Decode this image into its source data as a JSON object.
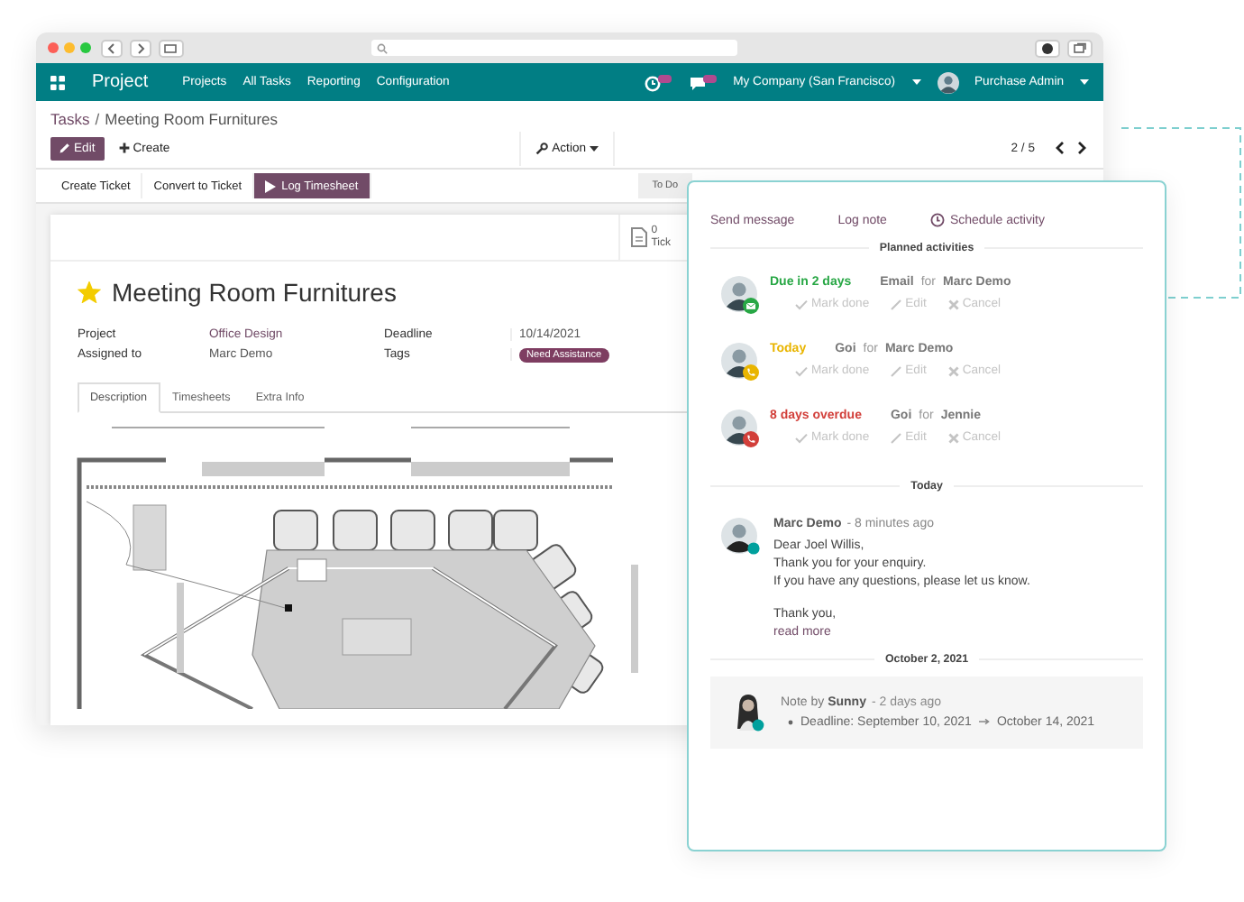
{
  "navbar": {
    "app": "Project",
    "menu": [
      {
        "label": "Projects"
      },
      {
        "label": "All Tasks"
      },
      {
        "label": "Reporting"
      },
      {
        "label": "Configuration"
      }
    ],
    "company": "My Company (San Francisco)",
    "user": "Purchase Admin"
  },
  "breadcrumb": {
    "separator": "/",
    "items": [
      {
        "label": "Tasks"
      },
      {
        "label": "Meeting Room Furnitures"
      }
    ]
  },
  "control_panel": {
    "edit": "Edit",
    "create": "Create",
    "action": "Action",
    "pager": "2 / 5"
  },
  "statusbar": {
    "buttons": [
      {
        "label": "Create Ticket",
        "primary": false
      },
      {
        "label": "Convert to Ticket",
        "primary": false
      },
      {
        "label": "Log Timesheet",
        "primary": true
      }
    ],
    "stage": "To Do"
  },
  "sheet": {
    "smart_button": {
      "count": "0",
      "label": "Tick"
    },
    "title": "Meeting Room Furnitures",
    "starred": true,
    "fields": [
      {
        "label": "Project",
        "value": "Office Design",
        "kind": "link"
      },
      {
        "label": "Deadline",
        "value": "10/14/2021",
        "kind": "text"
      },
      {
        "label": "Assigned to",
        "value": "Marc Demo",
        "kind": "text"
      },
      {
        "label": "Tags",
        "value": "Need Assistance",
        "kind": "tag"
      }
    ],
    "tabs": [
      {
        "label": "Description",
        "selected": true
      },
      {
        "label": "Timesheets",
        "selected": false
      },
      {
        "label": "Extra Info",
        "selected": false
      }
    ]
  },
  "chatter": {
    "actions": [
      {
        "label": "Send message",
        "kind": "plain"
      },
      {
        "label": "Log note",
        "kind": "plain"
      },
      {
        "label": "Schedule activity",
        "kind": "clock"
      }
    ],
    "planned_title": "Planned activities",
    "activities": [
      {
        "status": "Due in 2 days",
        "color": "#28a745",
        "kind": "email",
        "type": "Email",
        "for_label": "for",
        "assignee": "Marc Demo",
        "done": "Mark done",
        "edit": "Edit",
        "cancel": "Cancel"
      },
      {
        "status": "Today",
        "color": "#e9b500",
        "kind": "call",
        "type": "Goi",
        "for_label": "for",
        "assignee": "Marc Demo",
        "done": "Mark done",
        "edit": "Edit",
        "cancel": "Cancel"
      },
      {
        "status": "8 days overdue",
        "color": "#d23f3a",
        "kind": "call",
        "type": "Goi",
        "for_label": "for",
        "assignee": "Jennie",
        "done": "Mark done",
        "edit": "Edit",
        "cancel": "Cancel"
      }
    ],
    "today_title": "Today",
    "message": {
      "author": "Marc Demo",
      "time": "- 8 minutes ago",
      "body": [
        "Dear Joel Willis,\nThank you for your enquiry.\nIf you have any questions, please let us know.",
        "Thank you,"
      ],
      "more": "read more"
    },
    "date_title": "October 2, 2021",
    "note": {
      "header": "Note by **Sunny**",
      "time": "- 2 days ago",
      "label": "Deadline:",
      "old_value": "September 10, 2021",
      "new_value": "October 14, 2021"
    }
  }
}
